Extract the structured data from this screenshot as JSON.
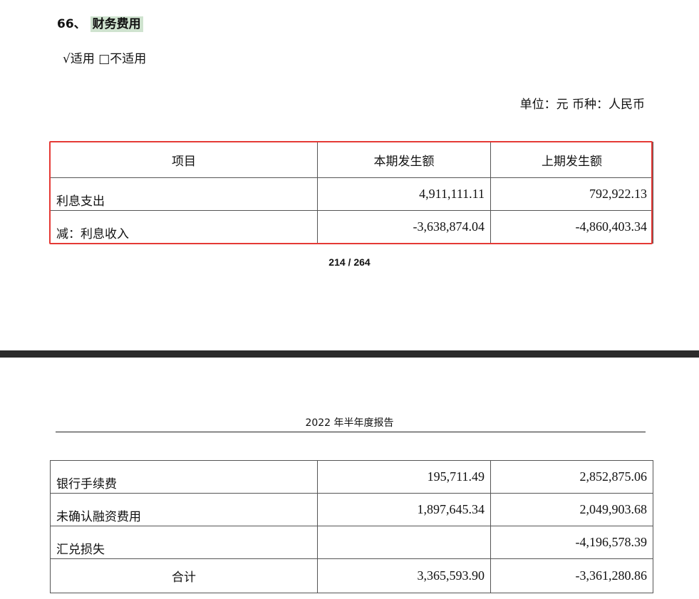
{
  "section": {
    "number": "66、",
    "title": "财务费用"
  },
  "applicability": "√适用 □不适用",
  "unit_line": "单位：元  币种：人民币",
  "table": {
    "headers": [
      "项目",
      "本期发生额",
      "上期发生额"
    ],
    "rows_page1": [
      {
        "item": "利息支出",
        "current": "4,911,111.11",
        "previous": "792,922.13"
      },
      {
        "item": "减：利息收入",
        "current": "-3,638,874.04",
        "previous": "-4,860,403.34"
      }
    ],
    "rows_page2": [
      {
        "item": "银行手续费",
        "current": "195,711.49",
        "previous": "2,852,875.06"
      },
      {
        "item": "未确认融资费用",
        "current": "1,897,645.34",
        "previous": "2,049,903.68"
      },
      {
        "item": "汇兑损失",
        "current": "",
        "previous": "-4,196,578.39"
      },
      {
        "item": "合计",
        "current": "3,365,593.90",
        "previous": "-3,361,280.86"
      }
    ]
  },
  "page_number": "214 / 264",
  "report_header": "2022 年半年度报告",
  "colors": {
    "highlight": "#cfe3cf",
    "frame": "#e53935",
    "separator": "#2b2b2b"
  }
}
